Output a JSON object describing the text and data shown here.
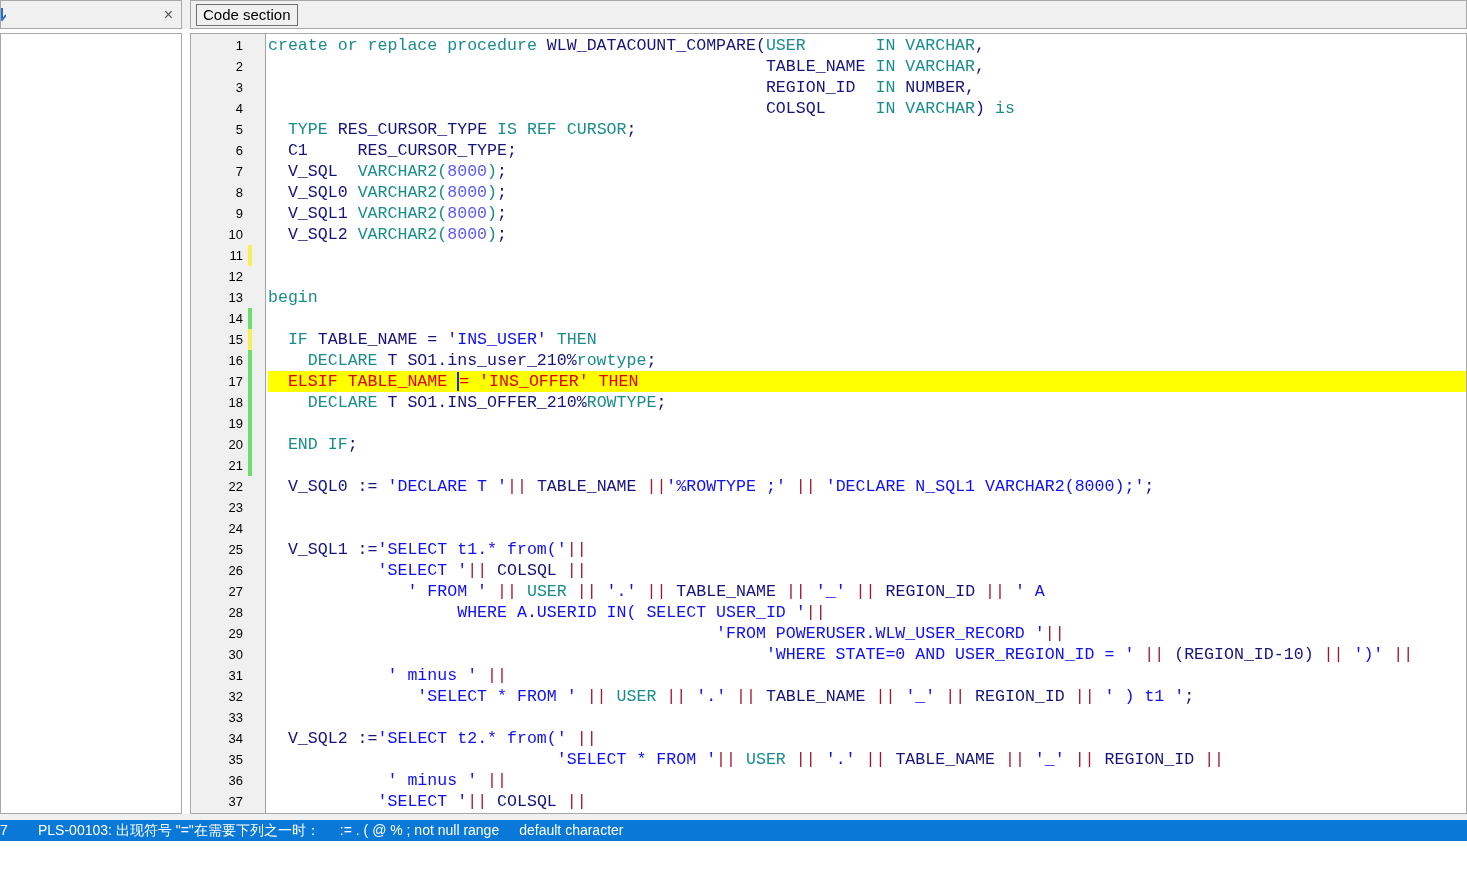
{
  "left_panel": {
    "close_glyph": "×"
  },
  "toolbar": {
    "button": "Code section"
  },
  "editor": {
    "lines": [
      {
        "number": "1",
        "segments": [
          {
            "text": "create or replace procedure ",
            "kind": "keyword"
          },
          {
            "text": "WLW_DATACOUNT_COMPARE(",
            "kind": "name"
          },
          {
            "text": "USER       IN VARCHAR",
            "kind": "keyword"
          },
          {
            "text": ",",
            "kind": "name"
          }
        ]
      },
      {
        "number": "2",
        "segments": [
          {
            "text": "                                                  TABLE_NAME ",
            "kind": "name"
          },
          {
            "text": "IN VARCHAR",
            "kind": "keyword"
          },
          {
            "text": ",",
            "kind": "name"
          }
        ]
      },
      {
        "number": "3",
        "segments": [
          {
            "text": "                                                  REGION_ID  ",
            "kind": "name"
          },
          {
            "text": "IN ",
            "kind": "keyword"
          },
          {
            "text": "NUMBER,",
            "kind": "name"
          }
        ]
      },
      {
        "number": "4",
        "segments": [
          {
            "text": "                                                  COLSQL     ",
            "kind": "name"
          },
          {
            "text": "IN VARCHAR",
            "kind": "keyword"
          },
          {
            "text": ") ",
            "kind": "name"
          },
          {
            "text": "is",
            "kind": "keyword"
          }
        ]
      },
      {
        "number": "5",
        "segments": [
          {
            "text": "  TYPE ",
            "kind": "keyword"
          },
          {
            "text": "RES_CURSOR_TYPE ",
            "kind": "name"
          },
          {
            "text": "IS REF CURSOR",
            "kind": "keyword"
          },
          {
            "text": ";",
            "kind": "name"
          }
        ]
      },
      {
        "number": "6",
        "segments": [
          {
            "text": "  C1     RES_CURSOR_TYPE;",
            "kind": "name"
          }
        ]
      },
      {
        "number": "7",
        "segments": [
          {
            "text": "  V_SQL  ",
            "kind": "name"
          },
          {
            "text": "VARCHAR2(",
            "kind": "keyword"
          },
          {
            "text": "8000",
            "kind": "number"
          },
          {
            "text": ")",
            "kind": "keyword"
          },
          {
            "text": ";",
            "kind": "name"
          }
        ]
      },
      {
        "number": "8",
        "segments": [
          {
            "text": "  V_SQL0 ",
            "kind": "name"
          },
          {
            "text": "VARCHAR2(",
            "kind": "keyword"
          },
          {
            "text": "8000",
            "kind": "number"
          },
          {
            "text": ")",
            "kind": "keyword"
          },
          {
            "text": ";",
            "kind": "name"
          }
        ]
      },
      {
        "number": "9",
        "segments": [
          {
            "text": "  V_SQL1 ",
            "kind": "name"
          },
          {
            "text": "VARCHAR2(",
            "kind": "keyword"
          },
          {
            "text": "8000",
            "kind": "number"
          },
          {
            "text": ")",
            "kind": "keyword"
          },
          {
            "text": ";",
            "kind": "name"
          }
        ]
      },
      {
        "number": "10",
        "segments": [
          {
            "text": "  V_SQL2 ",
            "kind": "name"
          },
          {
            "text": "VARCHAR2(",
            "kind": "keyword"
          },
          {
            "text": "8000",
            "kind": "number"
          },
          {
            "text": ")",
            "kind": "keyword"
          },
          {
            "text": ";",
            "kind": "name"
          }
        ]
      },
      {
        "number": "11",
        "color": "#f5f05a"
      },
      {
        "number": "12"
      },
      {
        "number": "13",
        "segments": [
          {
            "text": "begin",
            "kind": "keyword"
          }
        ]
      },
      {
        "number": "14",
        "color": "#6edc6e"
      },
      {
        "number": "15",
        "color": "#f5f05a",
        "segments": [
          {
            "text": "  IF ",
            "kind": "keyword"
          },
          {
            "text": "TABLE_NAME = ",
            "kind": "name"
          },
          {
            "text": "'INS_USER'",
            "kind": "string"
          },
          {
            "text": " THEN",
            "kind": "keyword"
          }
        ]
      },
      {
        "number": "16",
        "color": "#6edc6e",
        "segments": [
          {
            "text": "    DECLARE ",
            "kind": "keyword"
          },
          {
            "text": "T SO1.ins_user_210%",
            "kind": "name"
          },
          {
            "text": "rowtype",
            "kind": "keyword"
          },
          {
            "text": ";",
            "kind": "name"
          }
        ]
      },
      {
        "number": "17",
        "color": "#6edc6e",
        "error": true,
        "segments": [
          {
            "text": "  ELSIF TABLE_NAME ",
            "kind": "error"
          },
          {
            "text": "= 'INS_OFFER' THEN",
            "kind": "error",
            "cursor": true
          }
        ]
      },
      {
        "number": "18",
        "color": "#6edc6e",
        "segments": [
          {
            "text": "    DECLARE ",
            "kind": "keyword"
          },
          {
            "text": "T SO1.INS_OFFER_210%",
            "kind": "name"
          },
          {
            "text": "ROWTYPE",
            "kind": "keyword"
          },
          {
            "text": ";",
            "kind": "name"
          }
        ]
      },
      {
        "number": "19",
        "color": "#6edc6e"
      },
      {
        "number": "20",
        "color": "#6edc6e",
        "segments": [
          {
            "text": "  END IF",
            "kind": "keyword"
          },
          {
            "text": ";",
            "kind": "name"
          }
        ]
      },
      {
        "number": "21",
        "color": "#6edc6e"
      },
      {
        "number": "22",
        "segments": [
          {
            "text": "  V_SQL0 := ",
            "kind": "name"
          },
          {
            "text": "'DECLARE T '",
            "kind": "string"
          },
          {
            "text": "||",
            "kind": "operator"
          },
          {
            "text": " TABLE_NAME ",
            "kind": "name"
          },
          {
            "text": "||",
            "kind": "operator"
          },
          {
            "text": "'%ROWTYPE ;'",
            "kind": "string"
          },
          {
            "text": " || ",
            "kind": "operator"
          },
          {
            "text": "'DECLARE N_SQL1 VARCHAR2(8000);'",
            "kind": "string"
          },
          {
            "text": ";",
            "kind": "name"
          }
        ]
      },
      {
        "number": "23"
      },
      {
        "number": "24"
      },
      {
        "number": "25",
        "segments": [
          {
            "text": "  V_SQL1 :=",
            "kind": "name"
          },
          {
            "text": "'SELECT t1.* from('",
            "kind": "string"
          },
          {
            "text": "||",
            "kind": "operator"
          }
        ]
      },
      {
        "number": "26",
        "segments": [
          {
            "text": "           'SELECT '",
            "kind": "string"
          },
          {
            "text": "||",
            "kind": "operator"
          },
          {
            "text": " COLSQL ",
            "kind": "name"
          },
          {
            "text": "||",
            "kind": "operator"
          }
        ]
      },
      {
        "number": "27",
        "segments": [
          {
            "text": "              ' FROM '",
            "kind": "string"
          },
          {
            "text": " || ",
            "kind": "operator"
          },
          {
            "text": "USER",
            "kind": "keyword"
          },
          {
            "text": " || ",
            "kind": "operator"
          },
          {
            "text": "'.'",
            "kind": "string"
          },
          {
            "text": " || ",
            "kind": "operator"
          },
          {
            "text": "TABLE_NAME",
            "kind": "name"
          },
          {
            "text": " || ",
            "kind": "operator"
          },
          {
            "text": "'_'",
            "kind": "string"
          },
          {
            "text": " || ",
            "kind": "operator"
          },
          {
            "text": "REGION_ID",
            "kind": "name"
          },
          {
            "text": " || ",
            "kind": "operator"
          },
          {
            "text": "' A",
            "kind": "string"
          }
        ]
      },
      {
        "number": "28",
        "segments": [
          {
            "text": "                   WHERE A.USERID IN( SELECT USER_ID '",
            "kind": "string"
          },
          {
            "text": "||",
            "kind": "operator"
          }
        ]
      },
      {
        "number": "29",
        "segments": [
          {
            "text": "                                             'FROM POWERUSER.WLW_USER_RECORD '",
            "kind": "string"
          },
          {
            "text": "||",
            "kind": "operator"
          }
        ]
      },
      {
        "number": "30",
        "segments": [
          {
            "text": "                                                  'WHERE STATE=0 AND USER_REGION_ID = '",
            "kind": "string"
          },
          {
            "text": " || ",
            "kind": "operator"
          },
          {
            "text": "(REGION_ID-10)",
            "kind": "name"
          },
          {
            "text": " || ",
            "kind": "operator"
          },
          {
            "text": "')'",
            "kind": "string"
          },
          {
            "text": " ||",
            "kind": "operator"
          }
        ]
      },
      {
        "number": "31",
        "segments": [
          {
            "text": "            ' minus '",
            "kind": "string"
          },
          {
            "text": " ||",
            "kind": "operator"
          }
        ]
      },
      {
        "number": "32",
        "segments": [
          {
            "text": "               'SELECT * FROM '",
            "kind": "string"
          },
          {
            "text": " || ",
            "kind": "operator"
          },
          {
            "text": "USER",
            "kind": "keyword"
          },
          {
            "text": " || ",
            "kind": "operator"
          },
          {
            "text": "'.'",
            "kind": "string"
          },
          {
            "text": " || ",
            "kind": "operator"
          },
          {
            "text": "TABLE_NAME",
            "kind": "name"
          },
          {
            "text": " || ",
            "kind": "operator"
          },
          {
            "text": "'_'",
            "kind": "string"
          },
          {
            "text": " || ",
            "kind": "operator"
          },
          {
            "text": "REGION_ID",
            "kind": "name"
          },
          {
            "text": " || ",
            "kind": "operator"
          },
          {
            "text": "' ) t1 '",
            "kind": "string"
          },
          {
            "text": ";",
            "kind": "name"
          }
        ]
      },
      {
        "number": "33"
      },
      {
        "number": "34",
        "segments": [
          {
            "text": "  V_SQL2 :=",
            "kind": "name"
          },
          {
            "text": "'SELECT t2.* from('",
            "kind": "string"
          },
          {
            "text": " ||",
            "kind": "operator"
          }
        ]
      },
      {
        "number": "35",
        "segments": [
          {
            "text": "                             'SELECT * FROM '",
            "kind": "string"
          },
          {
            "text": "||",
            "kind": "operator"
          },
          {
            "text": " USER",
            "kind": "keyword"
          },
          {
            "text": " || ",
            "kind": "operator"
          },
          {
            "text": "'.'",
            "kind": "string"
          },
          {
            "text": " || ",
            "kind": "operator"
          },
          {
            "text": "TABLE_NAME",
            "kind": "name"
          },
          {
            "text": " || ",
            "kind": "operator"
          },
          {
            "text": "'_'",
            "kind": "string"
          },
          {
            "text": " || ",
            "kind": "operator"
          },
          {
            "text": "REGION_ID",
            "kind": "name"
          },
          {
            "text": " ||",
            "kind": "operator"
          }
        ]
      },
      {
        "number": "36",
        "segments": [
          {
            "text": "            ' minus '",
            "kind": "string"
          },
          {
            "text": " ||",
            "kind": "operator"
          }
        ]
      },
      {
        "number": "37",
        "segments": [
          {
            "text": "           'SELECT '",
            "kind": "string"
          },
          {
            "text": "||",
            "kind": "operator"
          },
          {
            "text": " COLSQL ",
            "kind": "name"
          },
          {
            "text": "||",
            "kind": "operator"
          }
        ]
      }
    ]
  },
  "status_bar": {
    "line": "7",
    "message": "PLS-00103: 出现符号 \"=\"在需要下列之一时：",
    "expected": [
      ":= . ( @ % ; not null range",
      "default character"
    ]
  }
}
